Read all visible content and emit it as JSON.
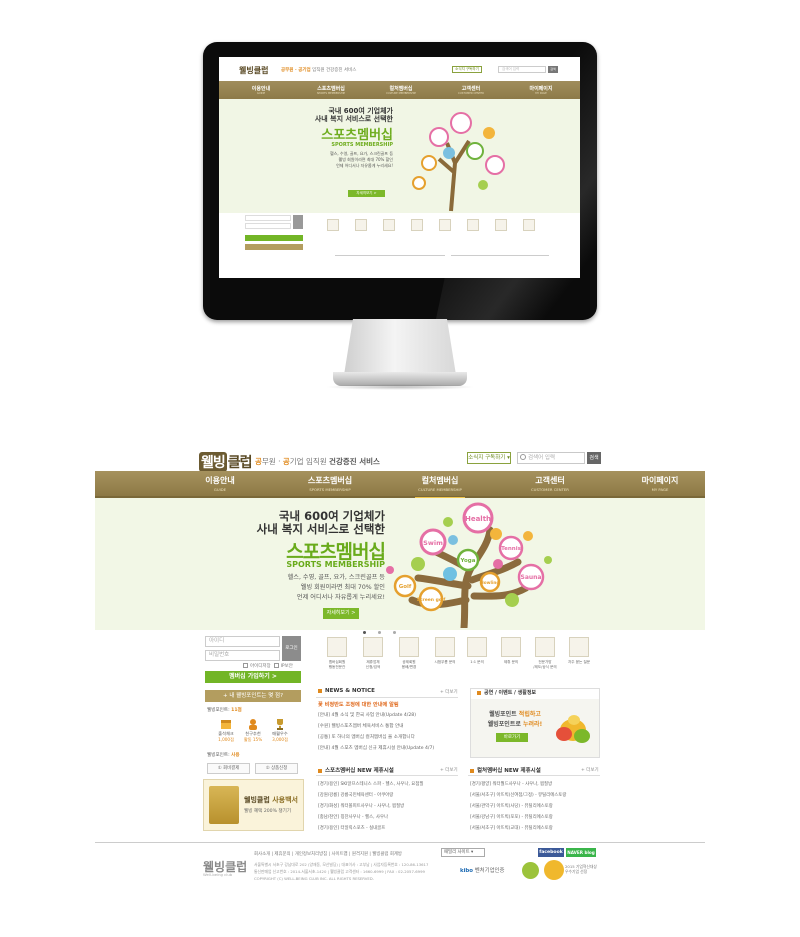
{
  "logo": {
    "badge": "웰빙",
    "rest": "클럽"
  },
  "tagline": {
    "prefix1": "공",
    "part1": "무원 · ",
    "prefix2": "공",
    "part2": "기업 임직원 ",
    "bold": "건강증진 서비스"
  },
  "header": {
    "corp_button": "소식지 구독하기 ▾",
    "search_placeholder": "검색어 입력",
    "search_button": "검색"
  },
  "nav": [
    {
      "label": "이용안내",
      "sub": "GUIDE"
    },
    {
      "label": "스포츠멤버십",
      "sub": "SPORTS MEMBERSHIP"
    },
    {
      "label": "컬처멤버십",
      "sub": "CULTURE MEMBERSHIP"
    },
    {
      "label": "고객센터",
      "sub": "CUSTOMER CENTER"
    },
    {
      "label": "마이페이지",
      "sub": "MY PAGE"
    }
  ],
  "banner": {
    "line1": "국내 600여 기업체가",
    "line2": "사내 복지 서비스로 선택한",
    "title": "스포츠멤버십",
    "subtitle": "SPORTS MEMBERSHIP",
    "desc1": "헬스, 수영, 골프, 요가, 스크린골프 등",
    "desc2": "웰빙 회원이라면 최대 70% 할인",
    "desc3": "언제 어디서나 자유롭게 누리세요!",
    "more": "자세히보기 >",
    "tree_labels": [
      "Health",
      "Swim",
      "Yoga",
      "Tennis",
      "Golf",
      "Sauna",
      "Screen golf",
      "Bowling"
    ]
  },
  "login": {
    "id_placeholder": "아이디",
    "pw_placeholder": "비밀번호",
    "button": "로그인",
    "save_id": "아이디저장",
    "save_pw": "IP보안",
    "join": "멤버십 가입하기 >",
    "find": "+ 내 웰빙포인트는 몇 점?",
    "point1_label": "웰빙포인트:",
    "point1_value": "11점",
    "point_items": [
      {
        "label": "출석체크",
        "value": "1,000점"
      },
      {
        "label": "친구추천",
        "value": "활동 15%"
      },
      {
        "label": "매월우수",
        "value": "3,000점"
      }
    ],
    "point2_label": "웰빙포인트:",
    "point2_value": "사용",
    "btn_left": "① 회비결제",
    "btn_right": "② 상품신청",
    "whitepaper_title": "웰빙클럽",
    "whitepaper_title_b": "사용백서",
    "whitepaper_sub": "웰빙 혜택 200% 챙기기"
  },
  "quick_menu": [
    "멤버십회원\n행동전문관",
    "제휴업체\n신청/검색",
    "공제회원\n용배/변경",
    "시범우롬 문의",
    "1:1 문의",
    "제휴 문의",
    "전문가방\n/제도/상식 문의",
    "자주 묻는 질문"
  ],
  "news": {
    "header": "NEWS & NOTICE",
    "more": "+ 더보기",
    "hot": "꽃 비정반도 조정에 대한 안내에 알림",
    "items": [
      "[안내] 4월 소식 및 한국 사업 안내(Update 4/28)",
      "[수원] 웰빙스포츠멤버 체육서비스 통합 안내",
      "[공통] 또 하나의 멤버십 컬처멤버십 을 소개합니다",
      "[안내] 4월 스포츠 멤버십 신규 제휴시설 안내(Update 4/7)"
    ]
  },
  "event": {
    "header": "공연 / 이벤트 / 생활정보",
    "title1": "웰빙포인트 ",
    "title1b": "적립하고",
    "title2": "웰빙포인트로 ",
    "title2b": "누려라!",
    "button": "바로가기"
  },
  "sports_list": {
    "header": "스포츠멤버십 NEW 제휴시설",
    "more": "+ 더보기",
    "items": [
      "[경기/용인] SKI알프스테니스 스파 - 헬스, 사우나, 요점필",
      "[강원/강릉] 강릉국민체육센터 - 아쿠아랑",
      "[경기/화성] 워터볼피트사우나 - 사우나, 찜질방",
      "[충남/천안] 칭찬사우나 - 헬스, 사우나",
      "[경기/용인] 터일릭스포츠 - 실내골프"
    ]
  },
  "culture_list": {
    "header": "컬처멤버십 NEW 제휴시설",
    "more": "+ 더보기",
    "items": [
      "[경기/평양] 워터월드사우나 - 사우나, 찜질방",
      "[서울/서초구] 아뜨빅(신여점/그정) - 뮤틸리에스토랑",
      "[서울/관악구] 아뜨빅(사당) - 뮤틸리에스토랑",
      "[서울/강남구] 아뜨빅(포포) - 뮤틸리에스토랑",
      "[서울/서초구] 아뜨빅(교대) - 뮤틸리에스토랑"
    ]
  },
  "footer": {
    "links": "회사소개  |  제휴문의  |  개인정보처리방침  |  사이트맵  |  원격지원  |  웰빙클럽 회계방",
    "family_site": "패밀리 사이트",
    "facebook": "facebook",
    "naver": "NAVER blog",
    "logo": "웰빙클럽",
    "logo_sub": "Well-being club",
    "addr1": "서울특별시 서초구 강남대로 202 (양재동, 모산빌딩) | 대표이사 : 고부남 | 사업자등록번호 : 120-86-13617",
    "addr2": "통신판매업 신고번호 : 2014-서울서초-1420 | 웰빙클럽 고객센터 : 1660-6999 | FAX : 02-2057-6999",
    "addr3": "COPYRIGHT (C) WELL-BEING CLUB INC. ALL RIGHTS RESERVED.",
    "kibo": "kibo",
    "kibo_text": " 벤처기업인증",
    "award": "2015 기업혁신대상\n우수기업 선정"
  },
  "mini": {
    "logo": "웰빙클럽",
    "tag_o": "공무원 · 공기업",
    "tag": " 임직원 건강증진 서비스",
    "corp": "소식지 구독하기",
    "search": "검색어 입력",
    "search_btn": "검색",
    "banner1": "국내 600여 기업체가",
    "banner2": "사내 복지 서비스로 선택한",
    "title": "스포츠멤버십",
    "sub": "SPORTS MEMBERSHIP",
    "desc": "헬스, 수영, 골프, 요가, 스크린골프 등\n웰빙 회원이라면 최대 70% 할인\n언제 어디서나 자유롭게 누리세요!",
    "more": "자세히보기 >"
  }
}
